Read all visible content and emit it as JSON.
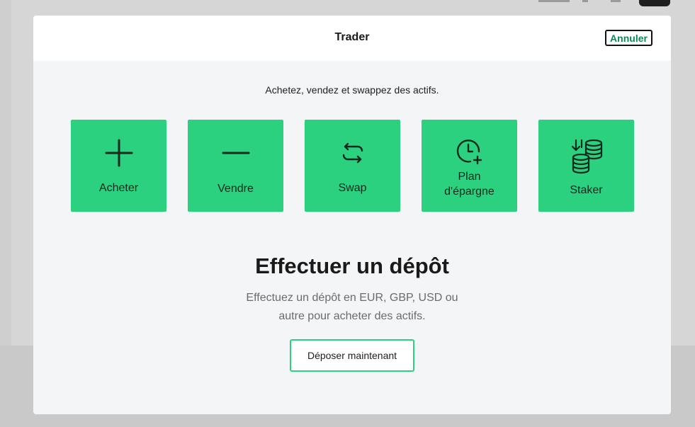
{
  "modal": {
    "title": "Trader",
    "cancel_label": "Annuler",
    "subtitle": "Achetez, vendez et swappez des actifs."
  },
  "actions": [
    {
      "label": "Acheter",
      "icon": "plus-icon"
    },
    {
      "label": "Vendre",
      "icon": "minus-icon"
    },
    {
      "label": "Swap",
      "icon": "swap-arrows-icon"
    },
    {
      "label_line1": "Plan",
      "label_line2": "d'épargne",
      "icon": "clock-plus-icon"
    },
    {
      "label": "Staker",
      "icon": "coins-stack-icon"
    }
  ],
  "deposit": {
    "title": "Effectuer un dépôt",
    "description_line1": "Effectuez un dépôt en EUR, GBP, USD ou",
    "description_line2": "autre pour acheter des actifs.",
    "button_label": "Déposer maintenant"
  },
  "colors": {
    "accent": "#2bd17f",
    "cancel_text": "#0a8a52",
    "overlay": "#cfcfcf"
  }
}
